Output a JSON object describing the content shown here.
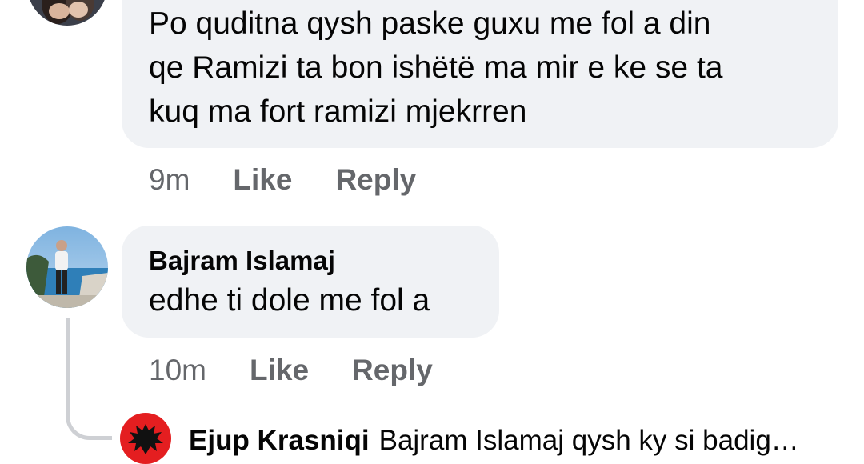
{
  "comment1": {
    "lines": [
      "Po quditna qysh paske guxu me fol a din",
      "qe Ramizi ta bon ishëtë ma mir e ke se ta",
      "kuq ma fort ramizi mjekrren"
    ],
    "time": "9m",
    "like_label": "Like",
    "reply_label": "Reply"
  },
  "comment2": {
    "author": "Bajram Islamaj",
    "text": "edhe ti dole me fol a",
    "time": "10m",
    "like_label": "Like",
    "reply_label": "Reply"
  },
  "reply_preview": {
    "author": "Ejup Krasniqi",
    "text": "Bajram Islamaj qysh ky si badig…"
  },
  "colors": {
    "bubble_bg": "#f0f2f5",
    "meta_text": "#65676b",
    "thread_line": "#ced0d4",
    "flag_red": "#e41e20"
  }
}
